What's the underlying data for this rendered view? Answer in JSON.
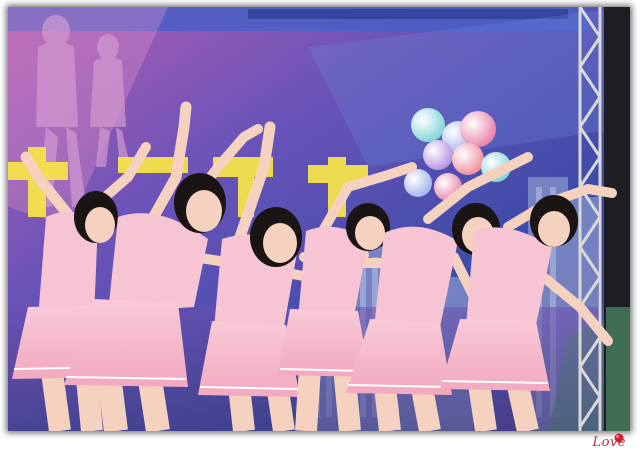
{
  "photo": {
    "subject": "stage-dance-performance",
    "colors": {
      "backdrop_blue": "#3f4fb0",
      "backdrop_purple": "#8a5fb8",
      "backdrop_pink": "#c87fc2",
      "outfit_pink": "#f7c4d4",
      "skin": "#f4d2bf",
      "hair": "#1b1414",
      "truss": "#d8d8d8",
      "banner_text": "#ffe94a"
    }
  },
  "signature": {
    "text": "Love",
    "color": "#c0283a"
  }
}
